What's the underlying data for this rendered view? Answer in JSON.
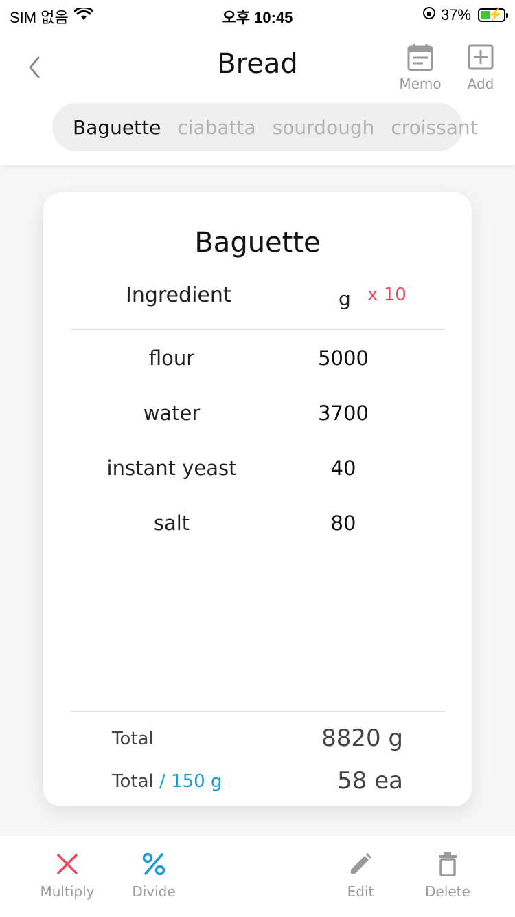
{
  "status_bar": {
    "carrier": "SIM 없음",
    "time": "오후 10:45",
    "battery": "37%"
  },
  "header": {
    "title": "Bread",
    "memo_label": "Memo",
    "add_label": "Add"
  },
  "tabs": [
    {
      "label": "Baguette",
      "active": true
    },
    {
      "label": "ciabatta",
      "active": false
    },
    {
      "label": "sourdough",
      "active": false
    },
    {
      "label": "croissant",
      "active": false
    }
  ],
  "recipe": {
    "title": "Baguette",
    "col_ingredient": "Ingredient",
    "col_unit": "g",
    "multiplier": "x 10",
    "rows": [
      {
        "name": "flour",
        "value": "5000"
      },
      {
        "name": "water",
        "value": "3700"
      },
      {
        "name": "instant yeast",
        "value": "40"
      },
      {
        "name": "salt",
        "value": "80"
      }
    ],
    "total_label": "Total",
    "total_value": "8820 g",
    "total_per_label": "Total",
    "total_per_accent": "/ 150 g",
    "total_per_value": "58 ea"
  },
  "toolbar": {
    "multiply_label": "Multiply",
    "divide_label": "Divide",
    "edit_label": "Edit",
    "delete_label": "Delete"
  },
  "colors": {
    "multiply": "#e84a5f",
    "divide": "#1a9ad6",
    "muted": "#9a9a9a"
  }
}
